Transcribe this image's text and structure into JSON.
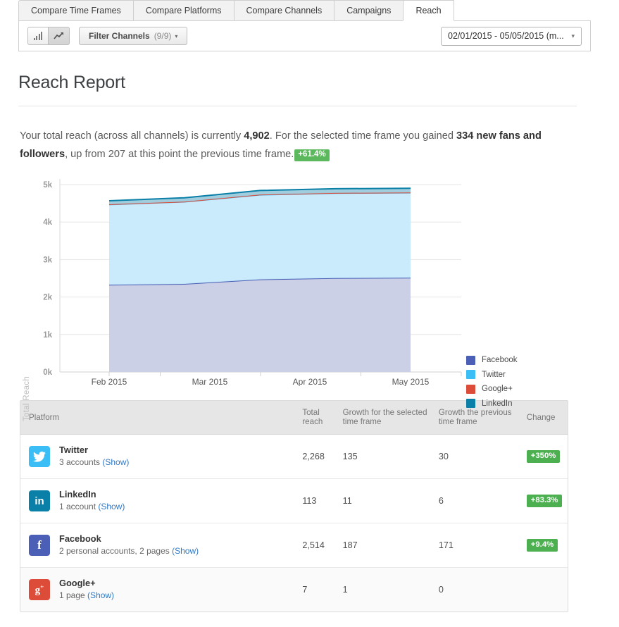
{
  "tabs": [
    {
      "label": "Compare Time Frames",
      "active": false
    },
    {
      "label": "Compare Platforms",
      "active": false
    },
    {
      "label": "Compare Channels",
      "active": false
    },
    {
      "label": "Campaigns",
      "active": false
    },
    {
      "label": "Reach",
      "active": true
    }
  ],
  "toolbar": {
    "bar_chart_icon": "bar-chart-icon",
    "line_chart_icon": "line-chart-icon",
    "filter_label": "Filter Channels",
    "filter_count": "(9/9)",
    "caret": "▾",
    "date_range": "02/01/2015 - 05/05/2015 (m...",
    "date_caret": "▾"
  },
  "header": {
    "title": "Reach Report"
  },
  "summary": {
    "part1": "Your total reach (across all channels) is currently ",
    "total_reach": "4,902",
    "part2": ". For the selected time frame you gained ",
    "gained": "334 new fans and followers",
    "part3": ", up from 207 at this point the previous time frame.",
    "change_pill": "+61.4%",
    "pill_color": "#5cb85c"
  },
  "chart_data": {
    "type": "area",
    "stacked": true,
    "title": "",
    "xlabel": "",
    "ylabel": "Total Reach",
    "x_ticks": [
      "Feb 2015",
      "Mar 2015",
      "Apr 2015",
      "May 2015"
    ],
    "y_ticks": [
      "0k",
      "1k",
      "2k",
      "3k",
      "4k",
      "5k"
    ],
    "ylim": [
      0,
      5000
    ],
    "grid": true,
    "legend_position": "right",
    "x": [
      "Feb 2015",
      "Mar 2015",
      "Apr 2015",
      "May 2015",
      "May 2015 (end)"
    ],
    "series": [
      {
        "name": "Facebook",
        "color": "#4a5fb5",
        "fill": "#c9cee6",
        "values": [
          2327,
          2350,
          2470,
          2505,
          2514
        ]
      },
      {
        "name": "Twitter",
        "color": "#3bbdf5",
        "fill": "#c7eafb",
        "values": [
          2140,
          2190,
          2255,
          2265,
          2268
        ]
      },
      {
        "name": "Google+",
        "color": "#dd4b39",
        "fill": "#f2b6ae",
        "values": [
          6,
          6,
          7,
          7,
          7
        ]
      },
      {
        "name": "LinkedIn",
        "color": "#0a7fa8",
        "fill": "#9ccbdc",
        "values": [
          95,
          102,
          110,
          112,
          113
        ]
      }
    ],
    "totals": [
      4568,
      4648,
      4842,
      4889,
      4902
    ]
  },
  "legend": [
    {
      "label": "Facebook",
      "color": "#4a5fb5"
    },
    {
      "label": "Twitter",
      "color": "#3bbdf5"
    },
    {
      "label": "Google+",
      "color": "#dd4b39"
    },
    {
      "label": "LinkedIn",
      "color": "#0a7fa8"
    }
  ],
  "table": {
    "headers": {
      "platform": "Platform",
      "total_reach": "Total reach",
      "growth_selected": "Growth for the selected time frame",
      "growth_previous": "Growth the previous time frame",
      "change": "Change"
    },
    "rows": [
      {
        "icon": "twitter-icon",
        "icon_color": "#3bbdf5",
        "icon_glyph": "🐦",
        "name": "Twitter",
        "accounts": "3 accounts ",
        "show_link": "(Show)",
        "total_reach": "2,268",
        "growth_selected": "135",
        "growth_previous": "30",
        "change": "+350%",
        "change_color": "#4caf50"
      },
      {
        "icon": "linkedin-icon",
        "icon_color": "#0a7fa8",
        "icon_glyph": "in",
        "name": "LinkedIn",
        "accounts": "1 account ",
        "show_link": "(Show)",
        "total_reach": "113",
        "growth_selected": "11",
        "growth_previous": "6",
        "change": "+83.3%",
        "change_color": "#4caf50"
      },
      {
        "icon": "facebook-icon",
        "icon_color": "#4a5fb5",
        "icon_glyph": "f",
        "name": "Facebook",
        "accounts": "2 personal accounts, 2 pages ",
        "show_link": "(Show)",
        "total_reach": "2,514",
        "growth_selected": "187",
        "growth_previous": "171",
        "change": "+9.4%",
        "change_color": "#4caf50"
      },
      {
        "icon": "googleplus-icon",
        "icon_color": "#dd4b39",
        "icon_glyph": "g+",
        "name": "Google+",
        "accounts": "1 page ",
        "show_link": "(Show)",
        "total_reach": "7",
        "growth_selected": "1",
        "growth_previous": "0",
        "change": "",
        "change_color": ""
      }
    ]
  }
}
